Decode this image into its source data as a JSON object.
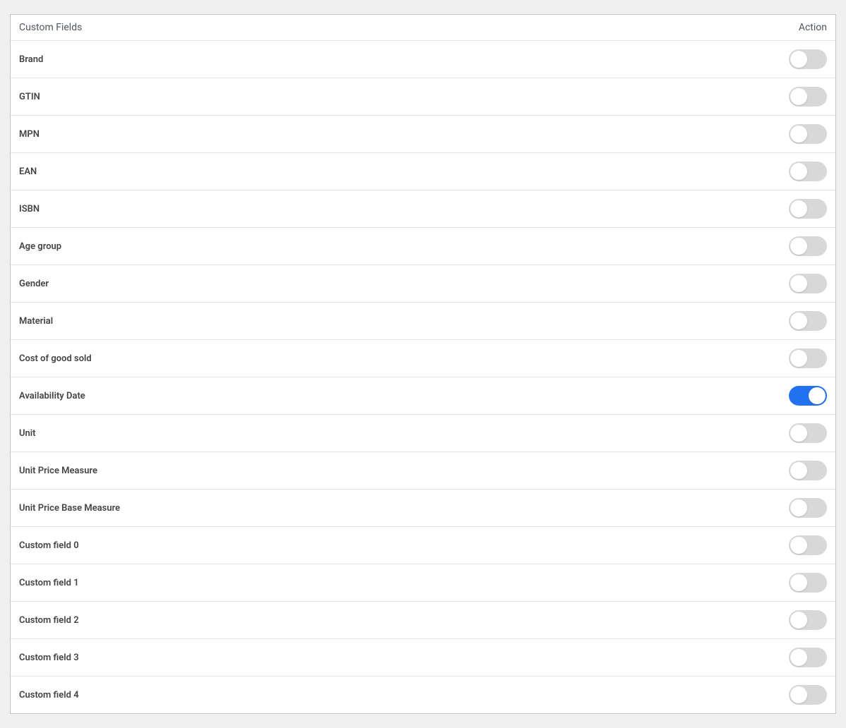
{
  "header": {
    "col_left": "Custom Fields",
    "col_right": "Action"
  },
  "rows": [
    {
      "label": "Brand",
      "enabled": false
    },
    {
      "label": "GTIN",
      "enabled": false
    },
    {
      "label": "MPN",
      "enabled": false
    },
    {
      "label": "EAN",
      "enabled": false
    },
    {
      "label": "ISBN",
      "enabled": false
    },
    {
      "label": "Age group",
      "enabled": false
    },
    {
      "label": "Gender",
      "enabled": false
    },
    {
      "label": "Material",
      "enabled": false
    },
    {
      "label": "Cost of good sold",
      "enabled": false
    },
    {
      "label": "Availability Date",
      "enabled": true
    },
    {
      "label": "Unit",
      "enabled": false
    },
    {
      "label": "Unit Price Measure",
      "enabled": false
    },
    {
      "label": "Unit Price Base Measure",
      "enabled": false
    },
    {
      "label": "Custom field 0",
      "enabled": false
    },
    {
      "label": "Custom field 1",
      "enabled": false
    },
    {
      "label": "Custom field 2",
      "enabled": false
    },
    {
      "label": "Custom field 3",
      "enabled": false
    },
    {
      "label": "Custom field 4",
      "enabled": false
    }
  ]
}
